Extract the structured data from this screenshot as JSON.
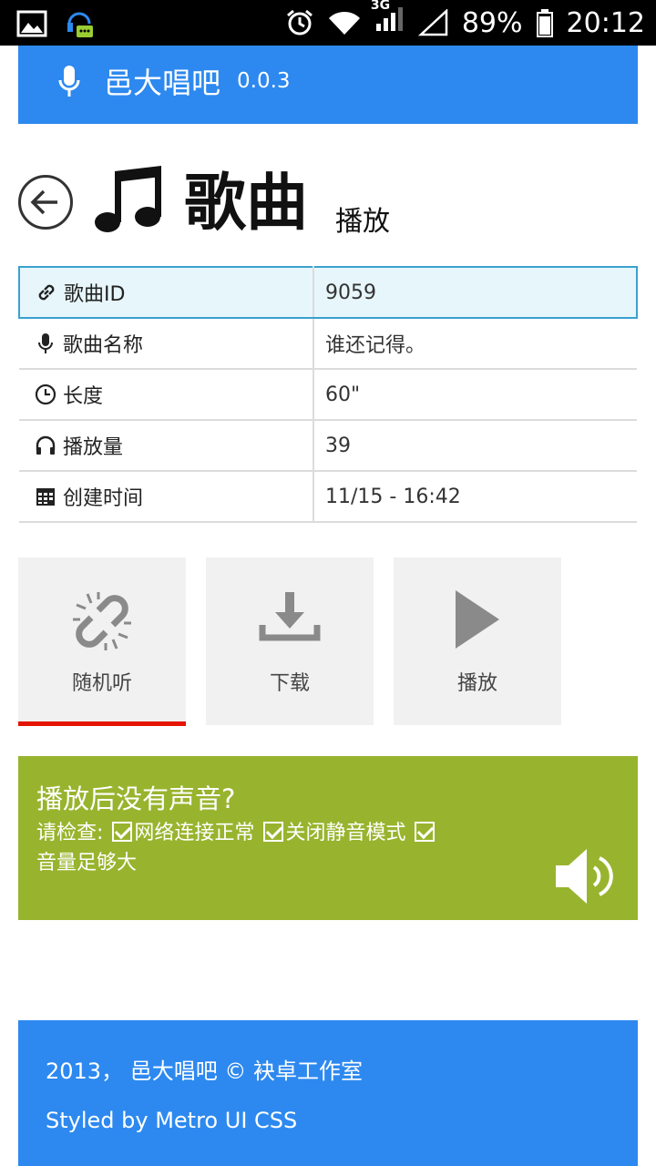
{
  "status_bar": {
    "network_tag": "3G",
    "battery_percent": "89%",
    "time": "20:12"
  },
  "header": {
    "title": "邑大唱吧",
    "version": "0.0.3"
  },
  "page": {
    "title": "歌曲",
    "subtitle": "播放"
  },
  "song_info": {
    "rows": [
      {
        "label": "歌曲ID",
        "value": "9059",
        "icon": "link-icon"
      },
      {
        "label": "歌曲名称",
        "value": "谁还记得。",
        "icon": "microphone-icon"
      },
      {
        "label": "长度",
        "value": "60\"",
        "icon": "clock-icon"
      },
      {
        "label": "播放量",
        "value": "39",
        "icon": "headphones-icon"
      },
      {
        "label": "创建时间",
        "value": "11/15 - 16:42",
        "icon": "calendar-icon"
      }
    ]
  },
  "actions": {
    "random": "随机听",
    "download": "下载",
    "play": "播放"
  },
  "notice": {
    "title": "播放后没有声音?",
    "prefix": "请检查:",
    "items": [
      "网络连接正常",
      "关闭静音模式",
      "音量足够大"
    ]
  },
  "footer": {
    "copyright": "2013， 邑大唱吧  © 袂卓工作室",
    "styled_by": "Styled by Metro UI CSS"
  },
  "colors": {
    "header_blue": "#2d89ef",
    "notice_green": "#98b42e",
    "selected_red": "#e51400",
    "highlight_border": "#3aa1cf"
  }
}
